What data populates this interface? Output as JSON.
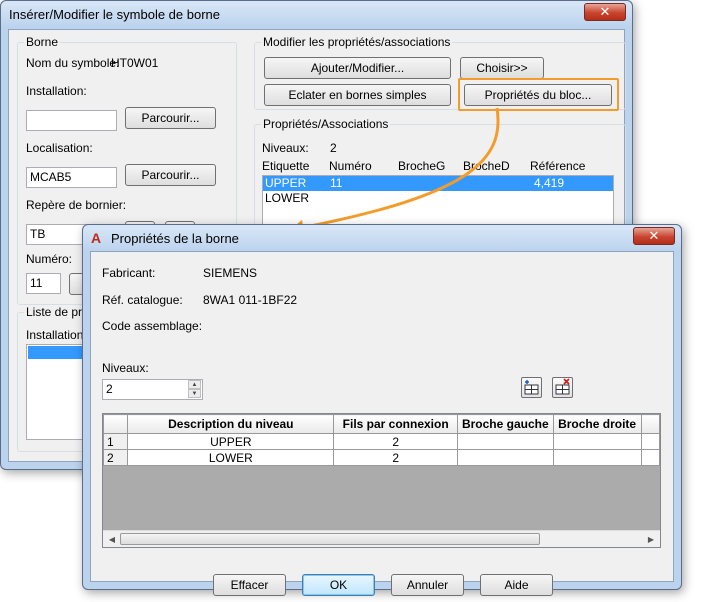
{
  "main_window": {
    "title": "Insérer/Modifier le symbole de borne",
    "close": "✕",
    "borne_group": "Borne",
    "symbol_name_label": "Nom du symbole:",
    "symbol_name_value": "HT0W01",
    "installation_label": "Installation:",
    "installation_value": "",
    "browse1": "Parcourir...",
    "localisation_label": "Localisation:",
    "localisation_value": "MCAB5",
    "browse2": "Parcourir...",
    "bornier_label": "Repère de bornier:",
    "bornier_value": "TB",
    "numero_label": "Numéro:",
    "numero_value": "11",
    "list_group": "Liste de proj",
    "list_col": "Installation",
    "modify_group": "Modifier les propriétés/associations",
    "add_modify": "Ajouter/Modifier...",
    "choose": "Choisir>>",
    "explode": "Eclater en bornes simples",
    "block_props": "Propriétés du bloc...",
    "props_group": "Propriétés/Associations",
    "levels_label": "Niveaux:",
    "levels_value": "2",
    "columns": [
      "Etiquette",
      "Numéro",
      "BrocheG",
      "BrocheD",
      "Référence"
    ],
    "rows": [
      {
        "etiquette": "UPPER",
        "numero": "11",
        "reference": "4,419"
      },
      {
        "etiquette": "LOWER",
        "numero": "",
        "reference": ""
      }
    ]
  },
  "dialog": {
    "title": "Propriétés de la borne",
    "close": "✕",
    "manufacturer_label": "Fabricant:",
    "manufacturer_value": "SIEMENS",
    "catalog_label": "Réf. catalogue:",
    "catalog_value": "8WA1 011-1BF22",
    "assembly_label": "Code assemblage:",
    "levels_label": "Niveaux:",
    "levels_value": "2",
    "columns": [
      "Description du niveau",
      "Fils par connexion",
      "Broche gauche",
      "Broche droite"
    ],
    "rows": [
      {
        "idx": "1",
        "description": "UPPER",
        "wires": "2"
      },
      {
        "idx": "2",
        "description": "LOWER",
        "wires": "2"
      }
    ],
    "buttons": {
      "clear": "Effacer",
      "ok": "OK",
      "cancel": "Annuler",
      "help": "Aide"
    }
  },
  "colors": {
    "highlight": "#f39c2b",
    "selection": "#3399ff"
  }
}
